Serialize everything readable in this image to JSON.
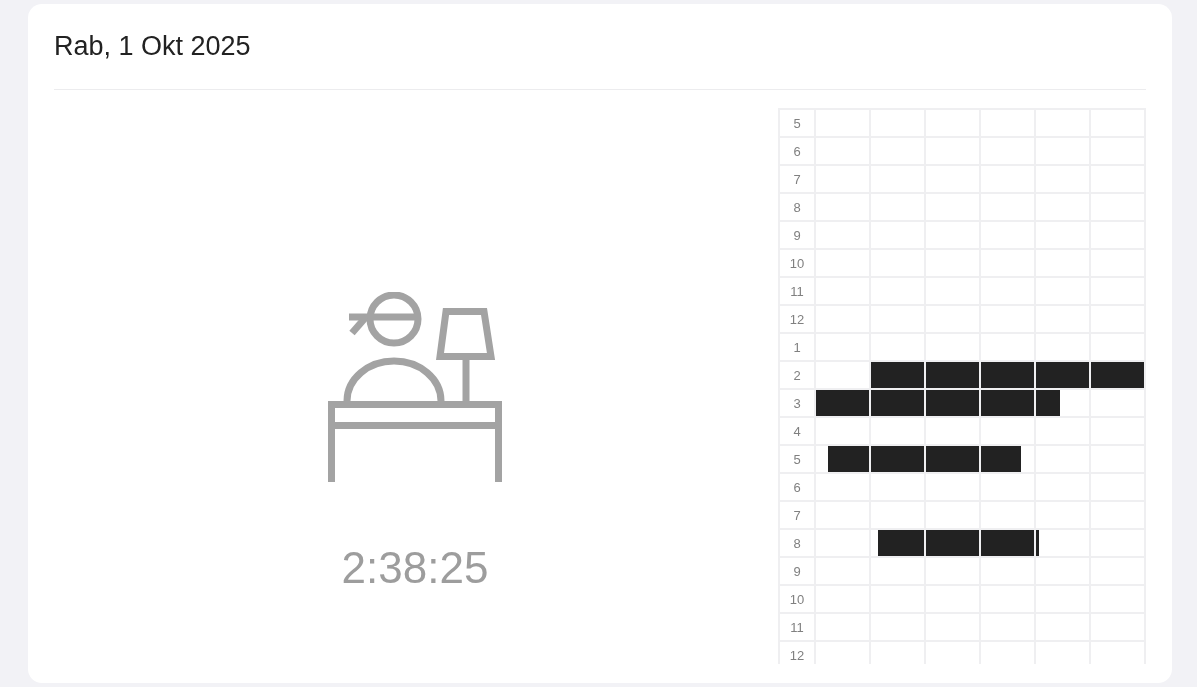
{
  "header": {
    "date": "Rab, 1 Okt 2025"
  },
  "status": {
    "elapsed": "2:38:25"
  },
  "timeline": {
    "rows": [
      {
        "hour": "5",
        "cells": [
          {
            "kind": "empty"
          },
          {
            "kind": "empty"
          },
          {
            "kind": "empty"
          },
          {
            "kind": "empty"
          },
          {
            "kind": "empty"
          },
          {
            "kind": "empty"
          }
        ]
      },
      {
        "hour": "6",
        "cells": [
          {
            "kind": "empty"
          },
          {
            "kind": "empty"
          },
          {
            "kind": "empty"
          },
          {
            "kind": "empty"
          },
          {
            "kind": "empty"
          },
          {
            "kind": "empty"
          }
        ]
      },
      {
        "hour": "7",
        "cells": [
          {
            "kind": "empty"
          },
          {
            "kind": "empty"
          },
          {
            "kind": "empty"
          },
          {
            "kind": "empty"
          },
          {
            "kind": "empty"
          },
          {
            "kind": "empty"
          }
        ]
      },
      {
        "hour": "8",
        "cells": [
          {
            "kind": "empty"
          },
          {
            "kind": "empty"
          },
          {
            "kind": "empty"
          },
          {
            "kind": "empty"
          },
          {
            "kind": "empty"
          },
          {
            "kind": "empty"
          }
        ]
      },
      {
        "hour": "9",
        "cells": [
          {
            "kind": "empty"
          },
          {
            "kind": "empty"
          },
          {
            "kind": "empty"
          },
          {
            "kind": "empty"
          },
          {
            "kind": "empty"
          },
          {
            "kind": "empty"
          }
        ]
      },
      {
        "hour": "10",
        "cells": [
          {
            "kind": "empty"
          },
          {
            "kind": "empty"
          },
          {
            "kind": "empty"
          },
          {
            "kind": "empty"
          },
          {
            "kind": "empty"
          },
          {
            "kind": "empty"
          }
        ]
      },
      {
        "hour": "11",
        "cells": [
          {
            "kind": "empty"
          },
          {
            "kind": "empty"
          },
          {
            "kind": "empty"
          },
          {
            "kind": "empty"
          },
          {
            "kind": "empty"
          },
          {
            "kind": "empty"
          }
        ]
      },
      {
        "hour": "12",
        "cells": [
          {
            "kind": "empty"
          },
          {
            "kind": "empty"
          },
          {
            "kind": "empty"
          },
          {
            "kind": "empty"
          },
          {
            "kind": "empty"
          },
          {
            "kind": "empty"
          }
        ]
      },
      {
        "hour": "1",
        "cells": [
          {
            "kind": "empty"
          },
          {
            "kind": "empty"
          },
          {
            "kind": "empty"
          },
          {
            "kind": "empty"
          },
          {
            "kind": "empty"
          },
          {
            "kind": "empty"
          }
        ]
      },
      {
        "hour": "2",
        "cells": [
          {
            "kind": "empty"
          },
          {
            "kind": "full"
          },
          {
            "kind": "full"
          },
          {
            "kind": "full"
          },
          {
            "kind": "full"
          },
          {
            "kind": "full"
          }
        ]
      },
      {
        "hour": "3",
        "cells": [
          {
            "kind": "full"
          },
          {
            "kind": "full"
          },
          {
            "kind": "full"
          },
          {
            "kind": "full"
          },
          {
            "kind": "ends",
            "level": 0.46
          },
          {
            "kind": "empty"
          }
        ]
      },
      {
        "hour": "4",
        "cells": [
          {
            "kind": "empty"
          },
          {
            "kind": "empty"
          },
          {
            "kind": "empty"
          },
          {
            "kind": "empty"
          },
          {
            "kind": "empty"
          },
          {
            "kind": "empty"
          }
        ]
      },
      {
        "hour": "5",
        "cells": [
          {
            "kind": "starts",
            "level": 0.78
          },
          {
            "kind": "full"
          },
          {
            "kind": "full"
          },
          {
            "kind": "ends",
            "level": 0.76
          },
          {
            "kind": "empty"
          },
          {
            "kind": "empty"
          }
        ]
      },
      {
        "hour": "6",
        "cells": [
          {
            "kind": "empty"
          },
          {
            "kind": "empty"
          },
          {
            "kind": "empty"
          },
          {
            "kind": "empty"
          },
          {
            "kind": "empty"
          },
          {
            "kind": "empty"
          }
        ]
      },
      {
        "hour": "7",
        "cells": [
          {
            "kind": "empty"
          },
          {
            "kind": "empty"
          },
          {
            "kind": "empty"
          },
          {
            "kind": "empty"
          },
          {
            "kind": "empty"
          },
          {
            "kind": "empty"
          }
        ]
      },
      {
        "hour": "8",
        "cells": [
          {
            "kind": "empty"
          },
          {
            "kind": "starts",
            "level": 0.87
          },
          {
            "kind": "full"
          },
          {
            "kind": "full"
          },
          {
            "kind": "ends",
            "level": 0.06
          },
          {
            "kind": "empty"
          }
        ]
      },
      {
        "hour": "9",
        "cells": [
          {
            "kind": "empty"
          },
          {
            "kind": "empty"
          },
          {
            "kind": "empty"
          },
          {
            "kind": "empty"
          },
          {
            "kind": "empty"
          },
          {
            "kind": "empty"
          }
        ]
      },
      {
        "hour": "10",
        "cells": [
          {
            "kind": "empty"
          },
          {
            "kind": "empty"
          },
          {
            "kind": "empty"
          },
          {
            "kind": "empty"
          },
          {
            "kind": "empty"
          },
          {
            "kind": "empty"
          }
        ]
      },
      {
        "hour": "11",
        "cells": [
          {
            "kind": "empty"
          },
          {
            "kind": "empty"
          },
          {
            "kind": "empty"
          },
          {
            "kind": "empty"
          },
          {
            "kind": "empty"
          },
          {
            "kind": "empty"
          }
        ]
      },
      {
        "hour": "12",
        "cells": [
          {
            "kind": "empty"
          },
          {
            "kind": "empty"
          },
          {
            "kind": "empty"
          },
          {
            "kind": "empty"
          },
          {
            "kind": "empty"
          },
          {
            "kind": "empty"
          }
        ]
      }
    ]
  }
}
